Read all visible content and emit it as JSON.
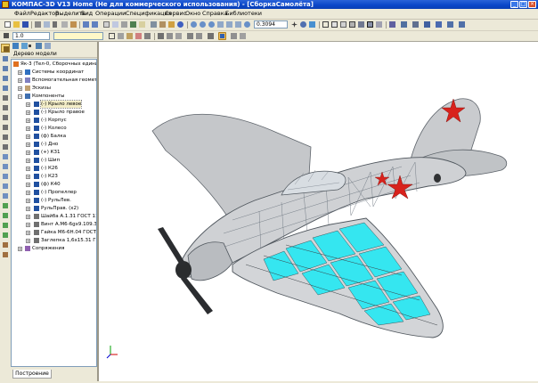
{
  "window": {
    "title": "КОМПАС-3D V13 Home (Не для коммерческого использования) - [СборкаСамолёта]",
    "buttons": [
      "_",
      "□",
      "×"
    ]
  },
  "menu": [
    "Файл",
    "Редактор",
    "Выделить",
    "Вид",
    "Операции",
    "Спецификация",
    "Сервис",
    "Окно",
    "Справка",
    "Библиотеки"
  ],
  "toolbar": {
    "zoom_value": "0.3094",
    "step_value": "1.0"
  },
  "tree": {
    "panel_title": "Дерево модели",
    "root": "Як-3 (Тел-0, Сборочных единиц",
    "items": [
      {
        "label": "Системы координат",
        "icon": "coord-icon"
      },
      {
        "label": "Вспомогательная геометрия",
        "icon": "aux-geometry-icon"
      },
      {
        "label": "Эскизы",
        "icon": "sketch-icon"
      },
      {
        "label": "Компоненты",
        "icon": "components-icon"
      }
    ],
    "components": [
      "(-) Крыло левое",
      "(-) Крыло правое",
      "(-) Корпус",
      "(-) Колесо",
      "(ф) Балка",
      "(-) Дно",
      "(+) К31",
      "(-) Шип",
      "(-) К26",
      "(-) К23",
      "(ф) К40",
      "(-) Пропеллер",
      "(-) РульЛев.",
      "РульПрав. (x2)",
      "Шайба А.1.31 ГОСТ 11",
      "Винт А.М6-6gx9.109.30",
      "Гайка М6-6Н.04 ГОСТ",
      "Заглепка 1,6х15.31 ГС"
    ],
    "mates": "Сопряжения",
    "bottom_tab": "Построение"
  },
  "colors": {
    "aircraft_body": "#c9cbce",
    "canopy_wireframe": "#6d7680",
    "wing_ribs_cyan": "#35e6f0",
    "star_red": "#d8221c",
    "titlebar_blue": "#0a46c8"
  },
  "axis_indicator": {
    "x": "x",
    "y": "y",
    "z": "z"
  }
}
